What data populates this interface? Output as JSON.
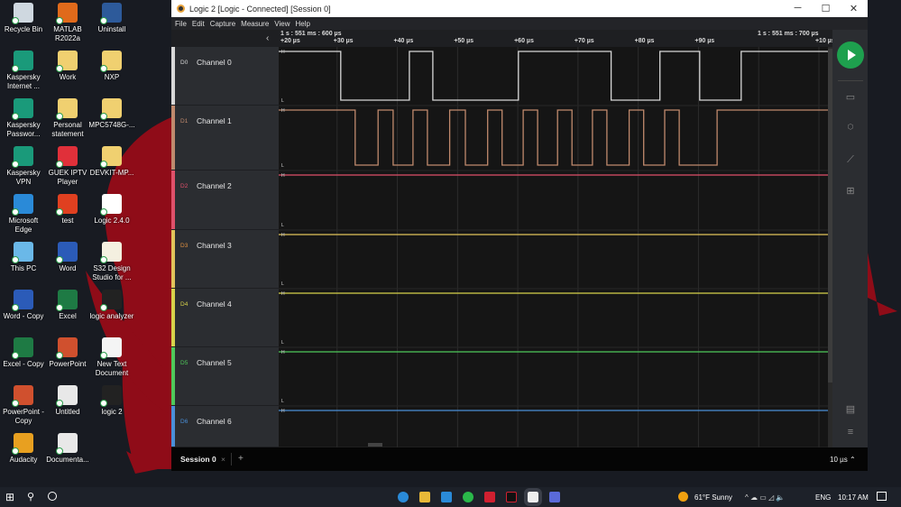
{
  "desktop": {
    "icons": [
      {
        "label": "Recycle Bin",
        "color": "#cfd8e0"
      },
      {
        "label": "MATLAB R2022a",
        "color": "#e06a1b"
      },
      {
        "label": "Uninstall",
        "color": "#2d5a9a"
      },
      {
        "label": "Kaspersky Internet ...",
        "color": "#1a9a7a"
      },
      {
        "label": "Work",
        "color": "#f0d070"
      },
      {
        "label": "NXP",
        "color": "#f0d070"
      },
      {
        "label": "Kaspersky Passwor...",
        "color": "#1a9a7a"
      },
      {
        "label": "Personal statement",
        "color": "#f0d070"
      },
      {
        "label": "MPC5748G-...",
        "color": "#f0d070"
      },
      {
        "label": "Kaspersky VPN",
        "color": "#1a9a7a"
      },
      {
        "label": "GUEK IPTV Player",
        "color": "#e0303a"
      },
      {
        "label": "DEVKIT-MP...",
        "color": "#f0d070"
      },
      {
        "label": "Microsoft Edge",
        "color": "#2a8ad8"
      },
      {
        "label": "test",
        "color": "#e04020"
      },
      {
        "label": "Logic 2.4.0",
        "color": "#ffffff"
      },
      {
        "label": "This PC",
        "color": "#6ab8e8"
      },
      {
        "label": "Word",
        "color": "#2b5bb8"
      },
      {
        "label": "S32 Design Studio for ...",
        "color": "#f4f0e0"
      },
      {
        "label": "Word - Copy",
        "color": "#2b5bb8"
      },
      {
        "label": "Excel",
        "color": "#1e7a44"
      },
      {
        "label": "logic analyzer",
        "color": "#222222"
      },
      {
        "label": "Excel - Copy",
        "color": "#1e7a44"
      },
      {
        "label": "PowerPoint",
        "color": "#d0502e"
      },
      {
        "label": "New Text Document",
        "color": "#f4f4f4"
      },
      {
        "label": "PowerPoint - Copy",
        "color": "#d0502e"
      },
      {
        "label": "Untitled",
        "color": "#e8e8e8"
      },
      {
        "label": "logic 2",
        "color": "#222222"
      },
      {
        "label": "Audacity",
        "color": "#e8a020"
      },
      {
        "label": "Documenta...",
        "color": "#e8e8e8"
      }
    ]
  },
  "window": {
    "title": "Logic 2 [Logic - Connected] [Session 0]",
    "minimize": "─",
    "maximize": "☐",
    "close": "✕",
    "menu": [
      "File",
      "Edit",
      "Capture",
      "Measure",
      "View",
      "Help"
    ]
  },
  "timeline": {
    "start_label": "1 s : 551 ms : 600 µs",
    "marker_label": "1 s : 551 ms : 700 µs",
    "ticks": [
      "+20 µs",
      "+30 µs",
      "+40 µs",
      "+50 µs",
      "+60 µs",
      "+70 µs",
      "+80 µs",
      "+90 µs",
      "",
      "+10 µs"
    ],
    "tick_times_us": [
      20,
      30,
      40,
      50,
      60,
      70,
      80,
      90,
      100,
      110
    ],
    "view_us": [
      20.3,
      111.5
    ],
    "collapse": "‹"
  },
  "channels": [
    {
      "id": "D0",
      "name": "Channel 0",
      "color": "#d8d8d8",
      "start_level": 1,
      "transitions_us": [
        30.6,
        42.0,
        45.9,
        60.1,
        75.5,
        83.6,
        90.2,
        97.1
      ]
    },
    {
      "id": "D1",
      "name": "Channel 1",
      "color": "#c08a6d",
      "start_level": 1,
      "transitions_us": [
        33.0,
        36.8,
        39.3,
        42.6,
        45.0,
        48.7,
        51.3,
        55.0,
        57.4,
        60.9,
        63.3,
        66.6,
        69.0,
        72.4,
        74.8,
        78.5,
        80.9,
        84.4,
        86.8,
        93.1
      ]
    },
    {
      "id": "D2",
      "name": "Channel 2",
      "color": "#e0506a",
      "start_level": 1,
      "transitions_us": []
    },
    {
      "id": "D3",
      "name": "Channel 3",
      "color": "#e2c45a",
      "label_color": "#e09040",
      "start_level": 1,
      "transitions_us": []
    },
    {
      "id": "D4",
      "name": "Channel 4",
      "color": "#d8d24a",
      "start_level": 1,
      "transitions_us": []
    },
    {
      "id": "D5",
      "name": "Channel 5",
      "color": "#4fc95a",
      "start_level": 1,
      "transitions_us": []
    },
    {
      "id": "D6",
      "name": "Channel 6",
      "color": "#4a8fd8",
      "start_level": 1,
      "transitions_us": []
    }
  ],
  "levels": {
    "high": "H",
    "low": "L"
  },
  "session": {
    "tab": "Session 0",
    "close": "×",
    "add": "+",
    "scale": "10 µs ⌃"
  },
  "taskbar": {
    "weather": "61°F  Sunny",
    "lang": "ENG",
    "time": "10:17 AM",
    "tray_icons": "^  ☁  ▭  ◿  🔈"
  }
}
